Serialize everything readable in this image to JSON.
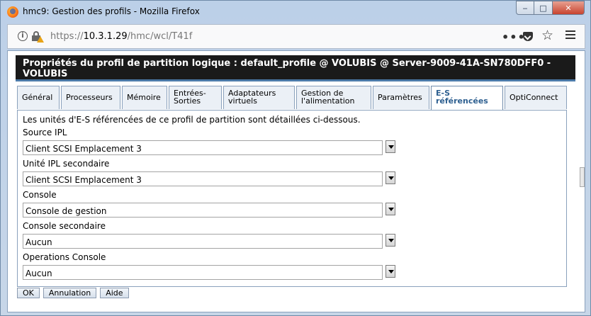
{
  "window": {
    "title": "hmc9: Gestion des profils - Mozilla Firefox",
    "controls": {
      "minimize": "‒",
      "maximize": "□",
      "close": "✕"
    }
  },
  "urlbar": {
    "url_prefix": "https://",
    "url_host": "10.3.1.29",
    "url_path": "/hmc/wcl/T41f",
    "actions_icon": "•••",
    "bookmark_icon": "☆"
  },
  "page": {
    "header_line1": "Propriétés du profil de partition logique : default_profile @ VOLUBIS @ Server-9009-41A-SN780DFF0 -",
    "header_line2": "VOLUBIS",
    "tabs": [
      {
        "label": "Général"
      },
      {
        "label": "Processeurs"
      },
      {
        "label": "Mémoire"
      },
      {
        "label_line1": "Entrées-",
        "label_line2": "Sorties"
      },
      {
        "label_line1": "Adaptateurs",
        "label_line2": "virtuels"
      },
      {
        "label_line1": "Gestion de",
        "label_line2": "l'alimentation"
      },
      {
        "label": "Paramètres"
      },
      {
        "label_line1": "E-S",
        "label_line2": "référencées",
        "active": true
      },
      {
        "label": "OptiConnect"
      }
    ],
    "intro": "Les unités d'E-S référencées de ce profil de partition sont détaillées ci-dessous.",
    "fields": [
      {
        "label": "Source IPL",
        "value": "Client SCSI Emplacement 3"
      },
      {
        "label": "Unité IPL secondaire",
        "value": "Client SCSI Emplacement 3"
      },
      {
        "label": "Console",
        "value": "Console de gestion"
      },
      {
        "label": "Console secondaire",
        "value": "Aucun"
      },
      {
        "label": "Operations Console",
        "value": "Aucun"
      }
    ],
    "buttons": {
      "ok": "OK",
      "cancel": "Annulation",
      "help": "Aide"
    }
  },
  "colors": {
    "header_bg": "#1a1a1a",
    "active_tab_text": "#2d5f90",
    "close_button": "#c8442f"
  }
}
